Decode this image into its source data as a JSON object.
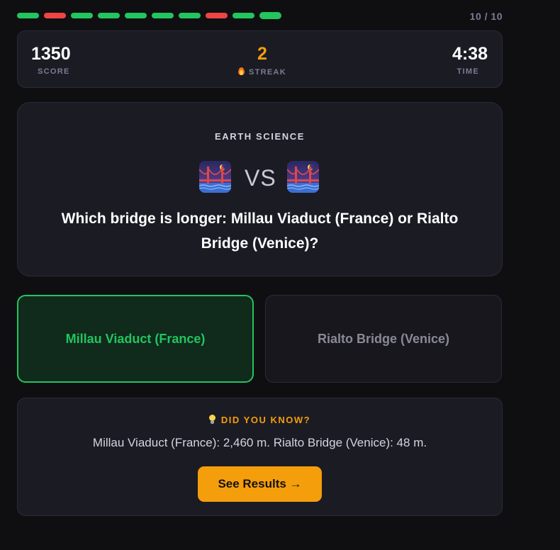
{
  "progress": {
    "segments": [
      "correct",
      "wrong",
      "correct",
      "correct",
      "correct",
      "correct",
      "correct",
      "wrong",
      "correct",
      "correct"
    ],
    "counter": "10 / 10",
    "colors": {
      "correct": "#22c55e",
      "wrong": "#ef4444"
    }
  },
  "stats": {
    "score_value": "1350",
    "score_label": "SCORE",
    "streak_value": "2",
    "streak_label": "STREAK",
    "streak_icon": "fire-icon",
    "time_value": "4:38",
    "time_label": "TIME"
  },
  "question": {
    "category": "EARTH SCIENCE",
    "left_icon": "bridge-at-night-icon",
    "vs_label": "VS",
    "right_icon": "bridge-at-night-icon",
    "text": "Which bridge is longer: Millau Viaduct (France) or Rialto Bridge (Venice)?"
  },
  "options": [
    {
      "label": "Millau Viaduct (France)",
      "state": "correct"
    },
    {
      "label": "Rialto Bridge (Venice)",
      "state": "not-selected"
    }
  ],
  "fact": {
    "icon": "lightbulb-icon",
    "title": "DID YOU KNOW?",
    "text": "Millau Viaduct (France): 2,460 m. Rialto Bridge (Venice): 48 m.",
    "button_label": "See Results →"
  },
  "colors": {
    "background": "#0f0f12",
    "card": "#1b1b24",
    "accent": "#f59e0b",
    "correct": "#22c55e",
    "wrong": "#ef4444"
  }
}
